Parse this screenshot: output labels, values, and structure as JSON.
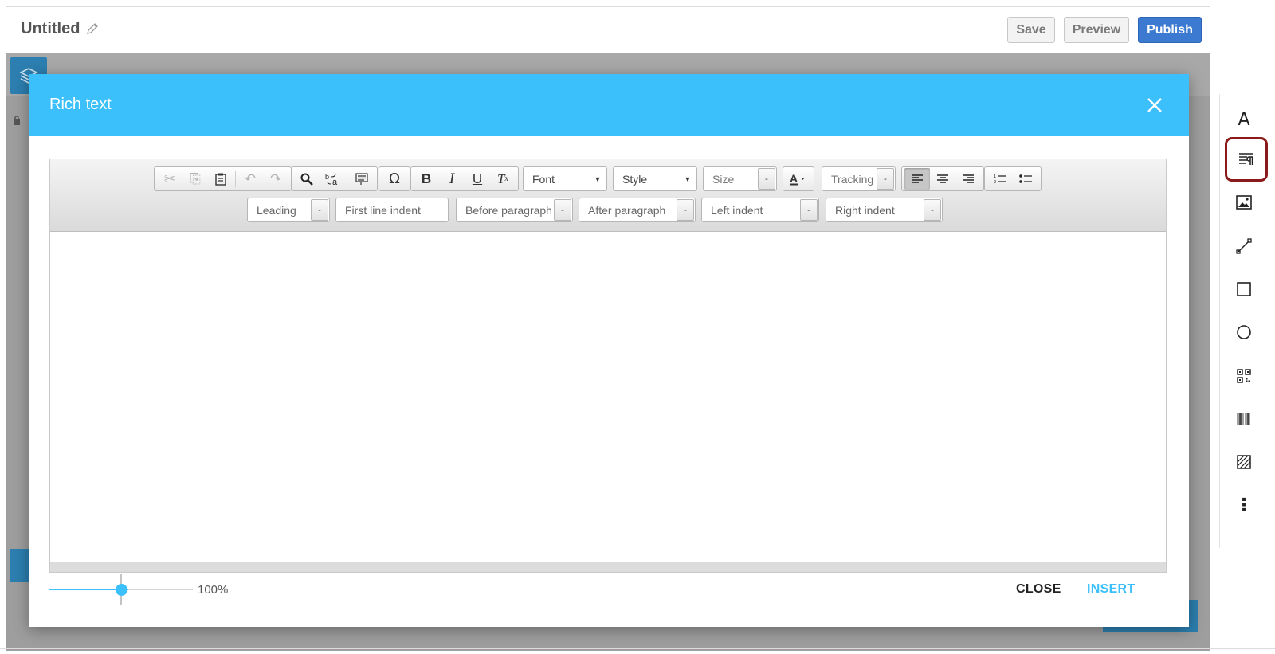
{
  "document": {
    "title": "Untitled"
  },
  "header": {
    "save_label": "Save",
    "preview_label": "Preview",
    "publish_label": "Publish"
  },
  "right_toolbar": {
    "items": [
      {
        "name": "text-icon",
        "glyph": "A"
      },
      {
        "name": "rich-text-icon",
        "glyph": "",
        "active": true
      },
      {
        "name": "image-icon",
        "glyph": ""
      },
      {
        "name": "line-icon",
        "glyph": ""
      },
      {
        "name": "rectangle-icon",
        "glyph": ""
      },
      {
        "name": "ellipse-icon",
        "glyph": ""
      },
      {
        "name": "qr-code-icon",
        "glyph": ""
      },
      {
        "name": "barcode-icon",
        "glyph": ""
      },
      {
        "name": "pattern-icon",
        "glyph": ""
      },
      {
        "name": "more-icon",
        "glyph": "⋮"
      }
    ]
  },
  "modal": {
    "title": "Rich text",
    "editor": {
      "font_placeholder": "Font",
      "style_placeholder": "Style",
      "size_placeholder": "Size",
      "tracking_label": "Tracking",
      "leading_label": "Leading",
      "first_line_indent_label": "First line indent",
      "before_paragraph_label": "Before paragraph",
      "after_paragraph_label": "After paragraph",
      "left_indent_label": "Left indent",
      "right_indent_label": "Right indent",
      "dropdown_glyph": "-"
    },
    "zoom": {
      "label": "100%",
      "value_fraction": 0.5
    },
    "close_label": "CLOSE",
    "insert_label": "INSERT"
  },
  "colors": {
    "header_blue": "#3bc0fb",
    "publish_blue": "#3b7ad0",
    "highlight": "#8b1a1a"
  }
}
